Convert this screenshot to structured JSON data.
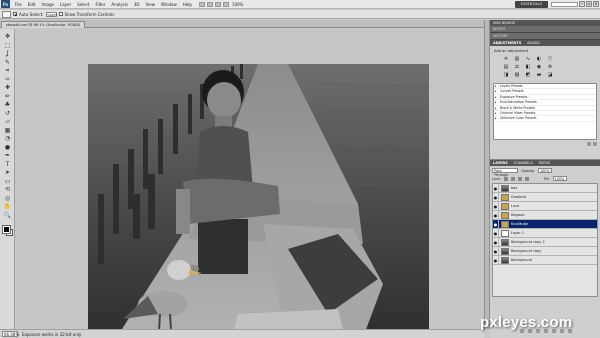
{
  "app": {
    "logo_text": "Ps",
    "workspace_label": "ESSENTIALS",
    "zoom": "100%"
  },
  "menu": [
    "File",
    "Edit",
    "Image",
    "Layer",
    "Select",
    "Filter",
    "Analysis",
    "3D",
    "View",
    "Window",
    "Help"
  ],
  "options_bar": {
    "auto_select_label": "Auto-Select:",
    "auto_select_value": "Layer",
    "transform_label": "Show Transform Controls"
  },
  "document_tab": {
    "label": "stepstill.psd @ 66.1% (Knollkutje, RGB/8)"
  },
  "status": {
    "zoom": "66.08%",
    "info": "Exposure works in 32-bit only"
  },
  "panels": {
    "tabs_top": [
      "MINI BRIDGE",
      "BRUSH",
      "HISTORY"
    ],
    "tabs_adjust": [
      "ADJUSTMENTS",
      "MASKS"
    ],
    "adj_title": "Add an adjustment",
    "presets": [
      "Levels Presets",
      "Curves Presets",
      "Exposure Presets",
      "Hue/Saturation Presets",
      "Black & White Presets",
      "Channel Mixer Presets",
      "Selective Color Presets"
    ],
    "layers_tabs": [
      "LAYERS",
      "CHANNELS",
      "PATHS"
    ],
    "blend_mode": "Pass Through",
    "opacity_label": "Opacity:",
    "opacity_value": "100%",
    "lock_label": "Lock:",
    "fill_label": "Fill:",
    "fill_value": "100%",
    "layers": [
      {
        "name": "bay",
        "type": "photo",
        "visible": true,
        "selected": false
      },
      {
        "name": "Gradient",
        "type": "folder",
        "visible": true,
        "selected": false
      },
      {
        "name": "Luce",
        "type": "folder",
        "visible": true,
        "selected": false
      },
      {
        "name": "Ragazzi",
        "type": "folder",
        "visible": true,
        "selected": false
      },
      {
        "name": "Knollkutje",
        "type": "folder",
        "visible": true,
        "selected": true
      },
      {
        "name": "Layer 1",
        "type": "blank",
        "visible": true,
        "selected": false
      },
      {
        "name": "Background copy 2",
        "type": "photo",
        "visible": true,
        "selected": false
      },
      {
        "name": "Background copy",
        "type": "photo",
        "visible": true,
        "selected": false
      },
      {
        "name": "Background",
        "type": "photo",
        "visible": true,
        "selected": false
      }
    ]
  },
  "tools": [
    "move-tool",
    "marquee-tool",
    "lasso-tool",
    "quick-select-tool",
    "crop-tool",
    "eyedropper-tool",
    "healing-tool",
    "brush-tool",
    "clone-tool",
    "history-brush-tool",
    "eraser-tool",
    "gradient-tool",
    "blur-tool",
    "dodge-tool",
    "pen-tool",
    "type-tool",
    "path-select-tool",
    "shape-tool",
    "3d-rotate-tool",
    "3d-orbit-tool",
    "hand-tool",
    "zoom-tool"
  ],
  "tool_glyphs": [
    "✥",
    "⬚",
    "ʆ",
    "✎",
    "⌗",
    "✑",
    "✚",
    "✏",
    "♣",
    "↺",
    "▱",
    "▦",
    "◔",
    "●",
    "✒",
    "T",
    "➤",
    "▭",
    "⟲",
    "◎",
    "✋",
    "🔍"
  ],
  "watermark": "pxleyes.com"
}
